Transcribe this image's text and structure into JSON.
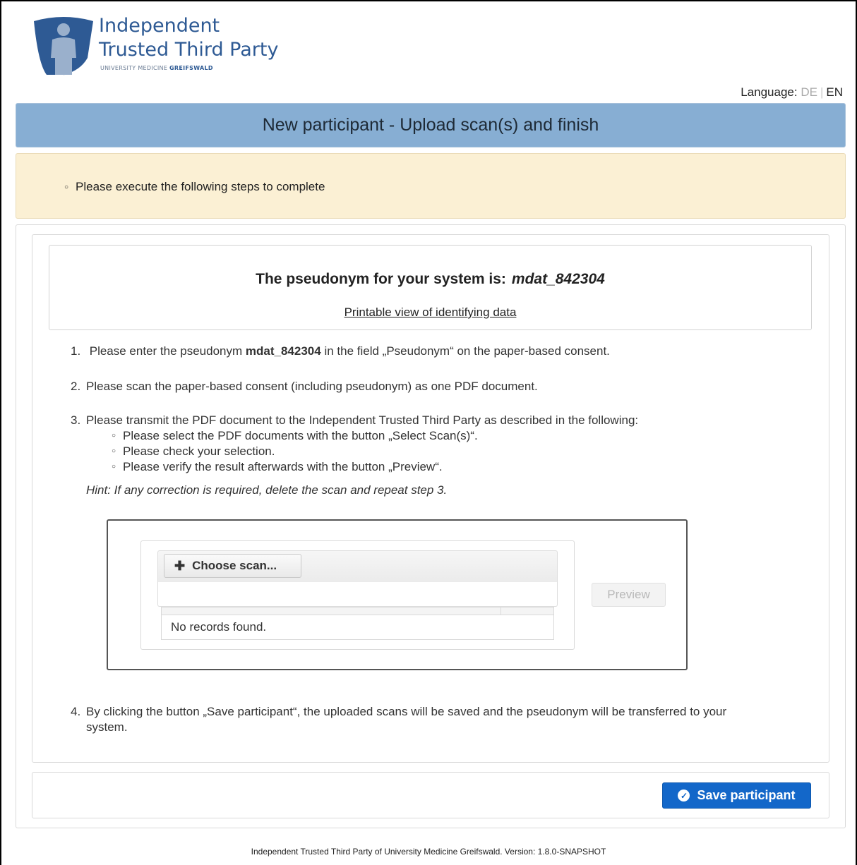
{
  "logo": {
    "line1": "Independent",
    "line2": "Trusted Third Party",
    "sub_prefix": "UNIVERSITY MEDICINE",
    "sub_bold": "GREIFSWALD"
  },
  "language": {
    "label": "Language:",
    "de": "DE",
    "en": "EN"
  },
  "header": {
    "title": "New participant - Upload scan(s) and finish"
  },
  "info": {
    "item": "Please execute the following steps to complete"
  },
  "pseudonym": {
    "prefix": "The pseudonym for your system is:",
    "value": "mdat_842304",
    "print_link": "Printable view of identifying data"
  },
  "steps": {
    "s1_num": "1.",
    "s1_a": "Please enter the pseudonym",
    "s1_pseudonym": "mdat_842304",
    "s1_b": "in the field „Pseudonym“ on the paper-based consent.",
    "s2_num": "2.",
    "s2": "Please scan the paper-based consent (including pseudonym) as one PDF document.",
    "s3_num": "3.",
    "s3": "Please transmit the PDF document to the Independent Trusted Third Party as described in the following:",
    "s3_sub": [
      "Please select the PDF documents with the button „Select Scan(s)“.",
      "Please check your selection.",
      "Please verify the result afterwards with the button „Preview“."
    ],
    "hint": "Hint: If any correction is required, delete the scan and repeat step 3.",
    "s4_num": "4.",
    "s4_line1": "By clicking the button „Save participant“, the uploaded scans will be saved and the pseudonym will be transferred to your",
    "s4_line2": "system."
  },
  "upload": {
    "choose_label": "Choose scan...",
    "empty_message": "No records found.",
    "preview_label": "Preview"
  },
  "actions": {
    "save_label": "Save participant"
  },
  "footer": {
    "text": "Independent Trusted Third Party of University Medicine Greifswald. Version: 1.8.0-SNAPSHOT"
  },
  "colors": {
    "title_bar": "#87aed3",
    "info_bg": "#fbf0d4",
    "save_button": "#1367c9",
    "logo_blue": "#2e5a94"
  }
}
